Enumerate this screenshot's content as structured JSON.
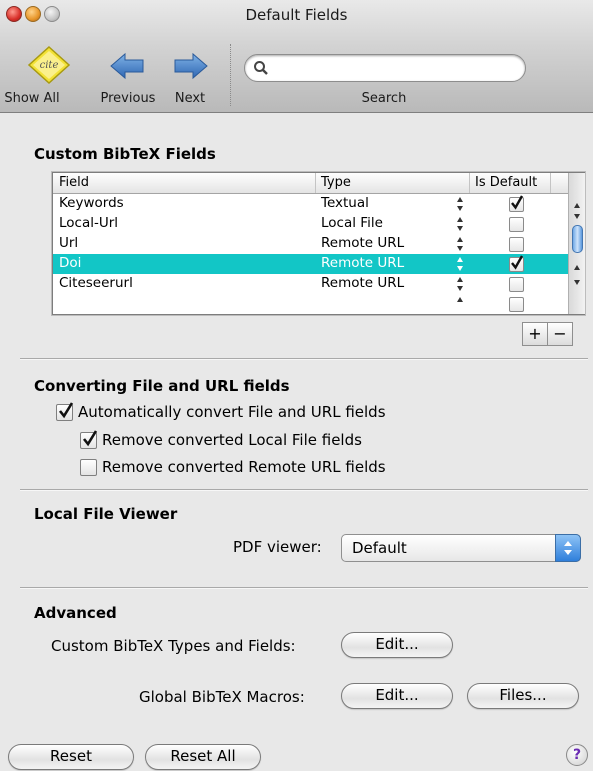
{
  "window": {
    "title": "Default Fields"
  },
  "toolbar": {
    "show_all": "Show All",
    "previous": "Previous",
    "next": "Next",
    "search_label": "Search",
    "search_value": "",
    "cite_text": "cite"
  },
  "custom_fields": {
    "title": "Custom BibTeX Fields",
    "headers": [
      "Field",
      "Type",
      "Is Default"
    ],
    "rows": [
      {
        "field": "Keywords",
        "type": "Textual",
        "is_default": true,
        "selected": false
      },
      {
        "field": "Local-Url",
        "type": "Local File",
        "is_default": false,
        "selected": false
      },
      {
        "field": "Url",
        "type": "Remote URL",
        "is_default": false,
        "selected": false
      },
      {
        "field": "Doi",
        "type": "Remote URL",
        "is_default": true,
        "selected": true
      },
      {
        "field": "Citeseerurl",
        "type": "Remote URL",
        "is_default": false,
        "selected": false
      }
    ],
    "add_label": "+",
    "remove_label": "−"
  },
  "converting": {
    "title": "Converting File and URL fields",
    "auto_convert": {
      "label": "Automatically convert File and URL fields",
      "checked": true
    },
    "remove_local": {
      "label": "Remove converted Local File fields",
      "checked": true
    },
    "remove_remote": {
      "label": "Remove converted Remote URL fields",
      "checked": false
    }
  },
  "viewer": {
    "title": "Local File Viewer",
    "pdf_label": "PDF viewer:",
    "pdf_value": "Default"
  },
  "advanced": {
    "title": "Advanced",
    "types_label": "Custom BibTeX Types and Fields:",
    "types_edit": "Edit...",
    "macros_label": "Global BibTeX Macros:",
    "macros_edit": "Edit...",
    "macros_files": "Files..."
  },
  "footer": {
    "reset": "Reset",
    "reset_all": "Reset All",
    "help": "?"
  },
  "colors": {
    "selection": "#12c6c6",
    "accent": "#2f7fdb"
  }
}
